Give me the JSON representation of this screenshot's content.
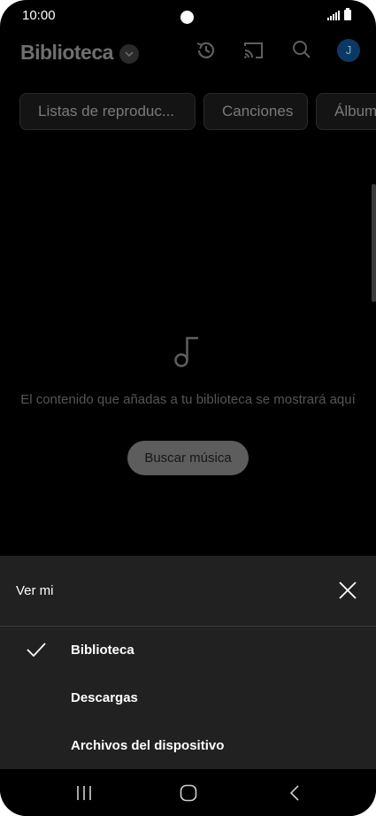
{
  "status_bar": {
    "time": "10:00"
  },
  "header": {
    "title": "Biblioteca",
    "icons": [
      "chevron-down-icon",
      "history-icon",
      "cast-icon",
      "search-icon"
    ],
    "avatar_initial": "J",
    "avatar_color": "#0a3a64"
  },
  "filter_chips": [
    {
      "label": "Listas de reproduc..."
    },
    {
      "label": "Canciones"
    },
    {
      "label": "Álbum"
    }
  ],
  "empty_state": {
    "icon": "music-note-icon",
    "message": "El contenido que añadas a tu biblioteca se mostrará aquí",
    "button_label": "Buscar música"
  },
  "sheet": {
    "title": "Ver mi",
    "options": [
      {
        "label": "Biblioteca",
        "selected": true
      },
      {
        "label": "Descargas",
        "selected": false
      },
      {
        "label": "Archivos del dispositivo",
        "selected": false
      }
    ]
  },
  "nav_bar": {
    "icons": [
      "recents-icon",
      "home-icon",
      "back-icon"
    ]
  }
}
